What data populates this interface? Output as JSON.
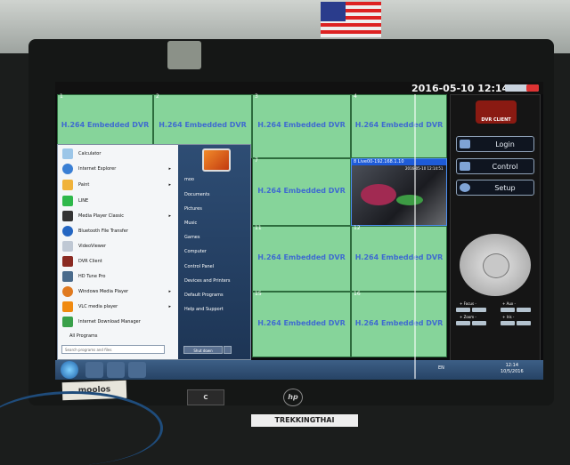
{
  "topbar": {
    "datetime": "2016-05-10 12:14:51"
  },
  "grid": {
    "cells": [
      {
        "num": "1",
        "label": "H.264 Embedded DVR"
      },
      {
        "num": "2",
        "label": "H.264 Embedded DVR"
      },
      {
        "num": "3",
        "label": "H.264 Embedded DVR"
      },
      {
        "num": "4",
        "label": "H.264 Embedded DVR"
      },
      {
        "num": "7",
        "label": "H.264 Embedded DVR"
      },
      {
        "num": "11",
        "label": "H.264 Embedded DVR"
      },
      {
        "num": "12",
        "label": "H.264 Embedded DVR"
      },
      {
        "num": "15",
        "label": "H.264 Embedded DVR"
      },
      {
        "num": "16",
        "label": "H.264 Embedded DVR"
      }
    ],
    "live": {
      "num": "8",
      "caption": "8 Live00-192.168.1.10",
      "timestamp": "2016-05-10 12:14:51"
    }
  },
  "panel": {
    "logo": "DVR CLIENT",
    "buttons": {
      "login": "Login",
      "control": "Control",
      "setup": "Setup"
    },
    "ptz_labels": {
      "focus": "+ Focus -",
      "iris_label": "+ Aux -",
      "zoom": "+ Zoom -",
      "iris": "+ Iris -"
    }
  },
  "startmenu": {
    "programs": [
      {
        "label": "Calculator",
        "color": "#9cc6e8"
      },
      {
        "label": "Internet Explorer",
        "color": "#3a7fd4",
        "arrow": "▸"
      },
      {
        "label": "Paint",
        "color": "#f0b23a",
        "arrow": "▸"
      },
      {
        "label": "LINE",
        "color": "#2fb84a"
      },
      {
        "label": "Media Player Classic",
        "color": "#333333",
        "arrow": "▸"
      },
      {
        "label": "Bluetooth File Transfer",
        "color": "#2466c2"
      },
      {
        "label": "VideoViewer",
        "color": "#bfc8d4"
      },
      {
        "label": "DVR Client",
        "color": "#8a2a22"
      },
      {
        "label": "HD Tune Pro",
        "color": "#4a6b8c"
      },
      {
        "label": "Windows Media Player",
        "color": "#e07a20",
        "arrow": "▸"
      },
      {
        "label": "VLC media player",
        "color": "#f08a10",
        "arrow": "▸"
      },
      {
        "label": "Internet Download Manager",
        "color": "#3aa04a"
      }
    ],
    "all_programs": "All Programs",
    "search_placeholder": "Search programs and files",
    "right_links": [
      "moo",
      "Documents",
      "Pictures",
      "Music",
      "Games",
      "Computer",
      "Control Panel",
      "Devices and Printers",
      "Default Programs",
      "Help and Support"
    ],
    "shutdown": "Shut down"
  },
  "taskbar": {
    "tray": "EN",
    "clock_time": "12:14",
    "clock_date": "10/5/2016"
  },
  "bezel": {
    "tape_label": "moolos",
    "badge": "C",
    "brand": "hp",
    "sign": "TREKKINGTHAI"
  }
}
